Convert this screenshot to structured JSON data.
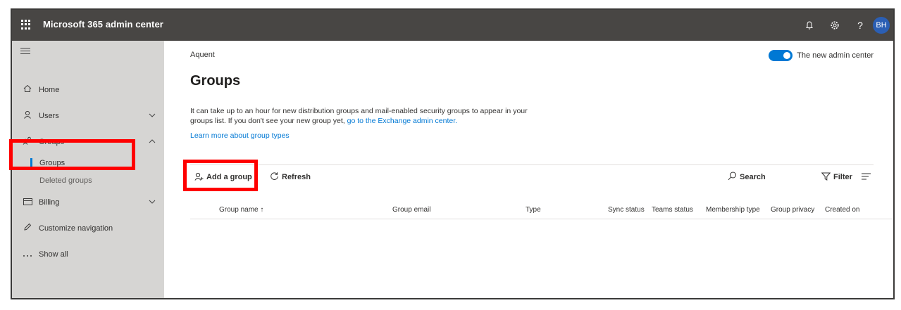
{
  "topbar": {
    "title": "Microsoft 365 admin center",
    "icons": [
      "bell-icon",
      "gear-icon",
      "help-icon"
    ],
    "help_glyph": "?",
    "avatar_initials": "BH"
  },
  "sidebar": {
    "items": [
      {
        "label": "Home",
        "icon": "home-icon"
      },
      {
        "label": "Users",
        "icon": "user-icon",
        "chevron": "down"
      },
      {
        "label": "Groups",
        "icon": "groups-icon",
        "chevron": "up"
      },
      {
        "label": "Billing",
        "icon": "billing-icon",
        "chevron": "down"
      },
      {
        "label": "Customize navigation",
        "icon": "pencil-icon"
      },
      {
        "label": "Show all",
        "icon": "ellipsis-icon"
      }
    ],
    "subitems": [
      {
        "label": "Groups",
        "selected": true
      },
      {
        "label": "Deleted groups"
      }
    ]
  },
  "main": {
    "breadcrumb": "Aquent",
    "toggle_label": "The new admin center",
    "title": "Groups",
    "description_text": "It can take up to an hour for new distribution groups and mail-enabled security groups to appear in your groups list. If you don't see your new group yet, ",
    "description_link": "go to the Exchange admin center.",
    "learn_more": "Learn more about group types"
  },
  "commands": {
    "add_group": "Add a group",
    "refresh": "Refresh",
    "search": "Search",
    "filter": "Filter"
  },
  "table": {
    "columns": [
      "Group name ↑",
      "Group email",
      "Type",
      "Sync status",
      "Teams status",
      "Membership type",
      "Group privacy",
      "Created on"
    ]
  },
  "colors": {
    "topbar": "#484644",
    "sidebar": "#d6d5d3",
    "accent": "#0078d4",
    "highlight": "#ff0000"
  }
}
